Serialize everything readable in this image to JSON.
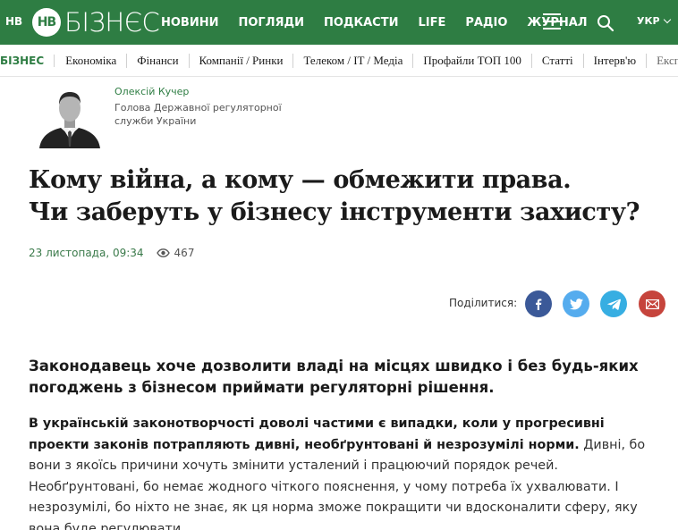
{
  "header": {
    "nv_label": "НВ",
    "logo_mark": "НВ",
    "logo_text": "БІЗНЄС",
    "nav": [
      "НОВИНИ",
      "ПОГЛЯДИ",
      "ПОДКАСТИ",
      "LIFE",
      "РАДІО",
      "ЖУРНАЛ"
    ],
    "menu_icon": "hamburger-icon",
    "search_icon": "search-icon",
    "language": "УКР"
  },
  "subnav": {
    "brand": "БІЗНЕС",
    "items": [
      "Економіка",
      "Фінанси",
      "Компанії / Ринки",
      "Телеком / IT / Медіа",
      "Профайли ТОП 100",
      "Статті",
      "Інтерв'ю",
      "Експе"
    ]
  },
  "author": {
    "name": "Олексій Кучер",
    "role": "Голова Державної регуляторної служби України"
  },
  "article": {
    "title_line1": "Кому війна, а кому — обмежити права.",
    "title_line2": "Чи заберуть у бізнесу інструменти захисту?",
    "date": "23 листопада, 09:34",
    "views": "467",
    "lead": "Законодавець хоче дозволити владі на місцях швидко і без будь-яких погоджень з бізнесом приймати регуляторні рішення.",
    "body_bold": "В українській законотворчості доволі частими є випадки, коли у прогресивні проекти законів потрапляють дивні, необґрунтовані й незрозумілі норми.",
    "body_rest": " Дивні, бо вони з якоїсь причини хочуть змінити усталений і працюючий порядок речей. Необґрунтовані, бо немає жодного чіткого пояснення, у чому потреба їх ухвалювати. І незрозумілі, бо ніхто не знає, як ця норма зможе покращити чи вдосконалити сферу, яку вона буде регулювати."
  },
  "share": {
    "label": "Поділитися:",
    "buttons": [
      {
        "icon": "facebook-icon",
        "color": "#3b5998"
      },
      {
        "icon": "twitter-icon",
        "color": "#55acee"
      },
      {
        "icon": "telegram-icon",
        "color": "#37aee2"
      },
      {
        "icon": "mail-icon",
        "color": "#c6443c"
      }
    ]
  },
  "colors": {
    "brand_green": "#2e7d43"
  }
}
